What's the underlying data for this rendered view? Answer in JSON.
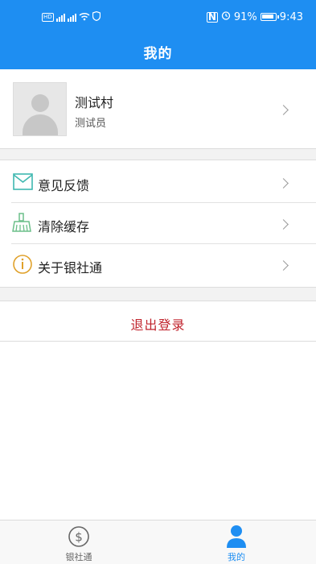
{
  "status_bar": {
    "battery": "91%",
    "time": "9:43"
  },
  "header": {
    "title": "我的"
  },
  "profile": {
    "name": "测试村",
    "role": "测试员"
  },
  "menu": {
    "items": [
      {
        "label": "意见反馈",
        "icon": "envelope-icon"
      },
      {
        "label": "清除缓存",
        "icon": "broom-icon"
      },
      {
        "label": "关于银社通",
        "icon": "info-icon"
      }
    ]
  },
  "logout": {
    "label": "退出登录"
  },
  "tabbar": {
    "tabs": [
      {
        "label": "银社通",
        "icon": "dollar-coin-icon",
        "active": false
      },
      {
        "label": "我的",
        "icon": "user-icon",
        "active": true
      }
    ]
  },
  "colors": {
    "primary": "#1e8ef2",
    "danger": "#c0232c",
    "info": "#e0a12a",
    "feedback": "#3fb8b0",
    "cache": "#6cbf8a"
  }
}
